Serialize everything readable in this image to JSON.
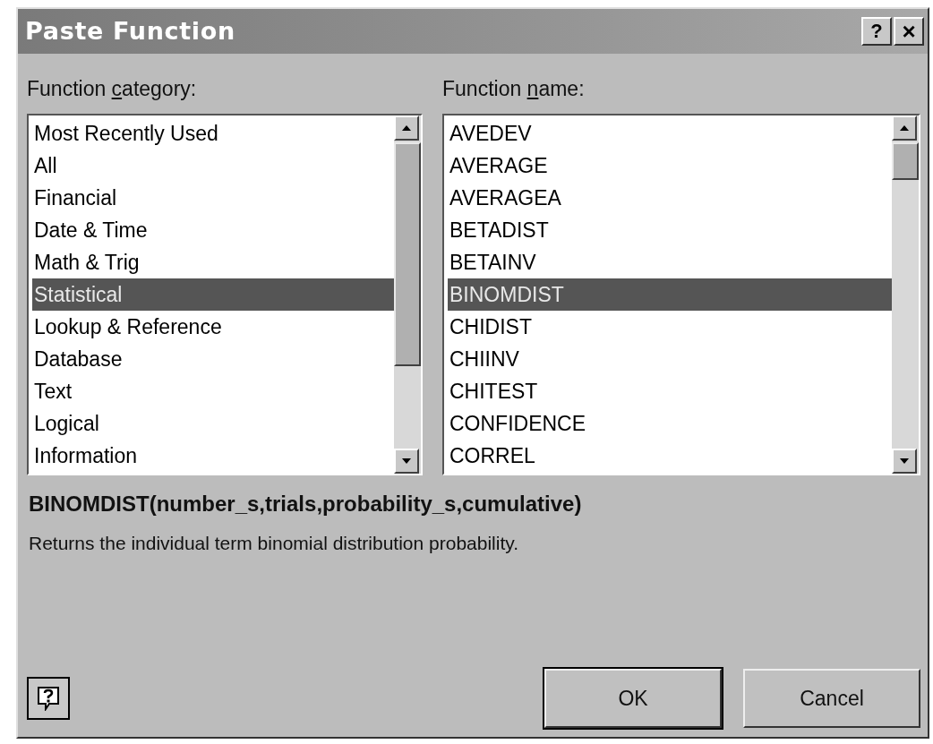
{
  "window": {
    "title": "Paste Function",
    "help_button": "?",
    "close_button": "×"
  },
  "category_list": {
    "label_parts": [
      "Function ",
      "c",
      "ategory:"
    ],
    "items": [
      {
        "label": "Most Recently Used",
        "selected": false
      },
      {
        "label": "All",
        "selected": false
      },
      {
        "label": "Financial",
        "selected": false
      },
      {
        "label": "Date & Time",
        "selected": false
      },
      {
        "label": "Math & Trig",
        "selected": false
      },
      {
        "label": "Statistical",
        "selected": true
      },
      {
        "label": "Lookup & Reference",
        "selected": false
      },
      {
        "label": "Database",
        "selected": false
      },
      {
        "label": "Text",
        "selected": false
      },
      {
        "label": "Logical",
        "selected": false
      },
      {
        "label": "Information",
        "selected": false
      }
    ]
  },
  "name_list": {
    "label_parts": [
      "Function ",
      "n",
      "ame:"
    ],
    "items": [
      {
        "label": "AVEDEV",
        "selected": false
      },
      {
        "label": "AVERAGE",
        "selected": false
      },
      {
        "label": "AVERAGEA",
        "selected": false
      },
      {
        "label": "BETADIST",
        "selected": false
      },
      {
        "label": "BETAINV",
        "selected": false
      },
      {
        "label": "BINOMDIST",
        "selected": true
      },
      {
        "label": "CHIDIST",
        "selected": false
      },
      {
        "label": "CHIINV",
        "selected": false
      },
      {
        "label": "CHITEST",
        "selected": false
      },
      {
        "label": "CONFIDENCE",
        "selected": false
      },
      {
        "label": "CORREL",
        "selected": false
      }
    ]
  },
  "signature": "BINOMDIST(number_s,trials,probability_s,cumulative)",
  "description": "Returns the individual term binomial distribution probability.",
  "buttons": [
    {
      "label": "OK",
      "default": true
    },
    {
      "label": "Cancel",
      "default": false
    }
  ]
}
